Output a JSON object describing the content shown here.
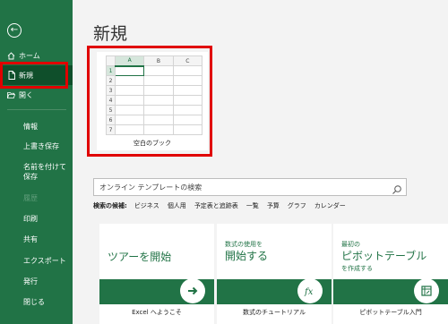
{
  "sidebar": {
    "back_icon": "←",
    "items": [
      {
        "label": "ホーム",
        "icon": "home-icon"
      },
      {
        "label": "新規",
        "icon": "new-file-icon"
      },
      {
        "label": "開く",
        "icon": "folder-open-icon"
      }
    ],
    "text_items": [
      {
        "label": "情報"
      },
      {
        "label": "上書き保存"
      },
      {
        "label": "名前を付けて保存"
      },
      {
        "label": "履歴"
      },
      {
        "label": "印刷"
      },
      {
        "label": "共有"
      },
      {
        "label": "エクスポート"
      },
      {
        "label": "発行"
      },
      {
        "label": "閉じる"
      }
    ]
  },
  "main": {
    "title": "新規",
    "blank_template": {
      "label": "空白のブック",
      "columns": [
        "A",
        "B",
        "C"
      ],
      "rows": [
        "1",
        "2",
        "3",
        "4",
        "5",
        "6",
        "7"
      ]
    },
    "search": {
      "placeholder": "オンライン テンプレートの検索"
    },
    "suggestions": {
      "label": "検索の候補:",
      "items": [
        "ビジネス",
        "個人用",
        "予定表と追跡表",
        "一覧",
        "予算",
        "グラフ",
        "カレンダー"
      ]
    },
    "cards": [
      {
        "title": "Excel へようこそ",
        "big_text": "ツアーを開始",
        "icon": "arrow-right-icon"
      },
      {
        "title": "数式のチュートリアル",
        "small_text": "数式の使用を",
        "big_text": "開始する",
        "icon": "fx-icon"
      },
      {
        "title": "ピボットテーブル入門",
        "small_text": "最初の",
        "big_text": "ピボットテーブル",
        "small_text2": "を作成する",
        "icon": "pivot-table-icon"
      }
    ]
  },
  "colors": {
    "accent": "#217346",
    "sidebar_active": "#0f4f2b",
    "highlight": "#e00000",
    "background": "#f3f3f3"
  }
}
